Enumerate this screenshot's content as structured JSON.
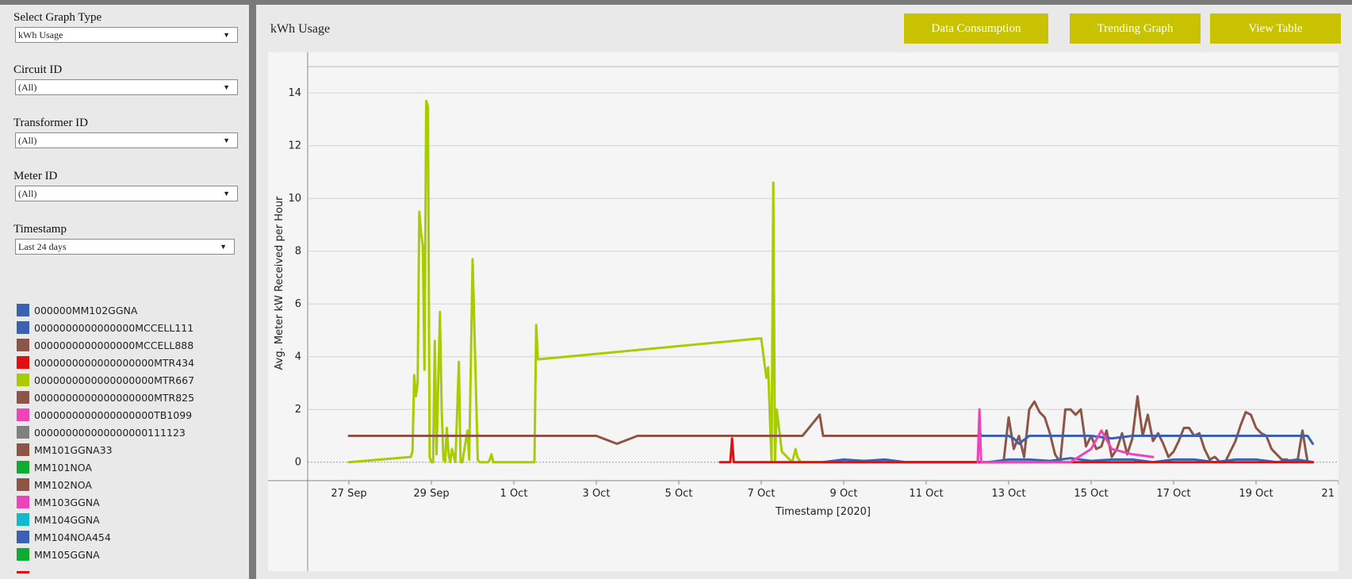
{
  "sidebar": {
    "filters": [
      {
        "label": "Select Graph Type",
        "value": "kWh Usage"
      },
      {
        "label": "Circuit ID",
        "value": "(All)"
      },
      {
        "label": "Transformer ID",
        "value": "(All)"
      },
      {
        "label": "Meter ID",
        "value": "(All)"
      },
      {
        "label": "Timestamp",
        "value": "Last 24 days"
      }
    ],
    "legend": [
      {
        "name": "000000MM102GGNA",
        "color": "#3a62b0"
      },
      {
        "name": "0000000000000000MCCELL111",
        "color": "#3a62b0"
      },
      {
        "name": "0000000000000000MCCELL888",
        "color": "#8c5545"
      },
      {
        "name": "0000000000000000000MTR434",
        "color": "#dd1111"
      },
      {
        "name": "0000000000000000000MTR667",
        "color": "#a8cc00"
      },
      {
        "name": "0000000000000000000MTR825",
        "color": "#8c5545"
      },
      {
        "name": "0000000000000000000TB1099",
        "color": "#ee44bb"
      },
      {
        "name": "000000000000000000111123",
        "color": "#808080"
      },
      {
        "name": "MM101GGNA33",
        "color": "#8c5545"
      },
      {
        "name": "MM101NOA",
        "color": "#11aa33"
      },
      {
        "name": "MM102NOA",
        "color": "#8c5545"
      },
      {
        "name": "MM103GGNA",
        "color": "#ee44bb"
      },
      {
        "name": "MM104GGNA",
        "color": "#11bbcc"
      },
      {
        "name": "MM104NOA454",
        "color": "#3a62b0"
      },
      {
        "name": "MM105GGNA",
        "color": "#11aa33"
      }
    ]
  },
  "main": {
    "title": "kWh Usage",
    "buttons": [
      "Data Consumption",
      "Trending Graph",
      "View Table"
    ],
    "button_color": "#c8c200"
  },
  "chart_data": {
    "type": "line",
    "xlabel": "Timestamp [2020]",
    "ylabel": "Avg. Meter kW Received per Hour",
    "ylim": [
      -0.7,
      15
    ],
    "xlim": [
      "2020-09-26",
      "2020-10-21"
    ],
    "yticks": [
      0,
      2,
      4,
      6,
      8,
      10,
      12,
      14
    ],
    "xticks": [
      "27 Sep",
      "29 Sep",
      "1 Oct",
      "3 Oct",
      "5 Oct",
      "7 Oct",
      "9 Oct",
      "11 Oct",
      "13 Oct",
      "15 Oct",
      "17 Oct",
      "19 Oct",
      "21 Oct"
    ],
    "grid": true,
    "series": [
      {
        "name": "0000000000000000000MTR667",
        "color": "#a8cc00",
        "x": [
          "2020-09-27T00:00",
          "2020-09-28T12:00",
          "2020-09-28T13:00",
          "2020-09-28T14:00",
          "2020-09-28T15:00",
          "2020-09-28T16:00",
          "2020-09-28T17:00",
          "2020-09-28T18:00",
          "2020-09-28T19:00",
          "2020-09-28T20:00",
          "2020-09-28T21:00",
          "2020-09-28T22:00",
          "2020-09-28T23:00",
          "2020-09-29T00:00",
          "2020-09-29T01:00",
          "2020-09-29T02:00",
          "2020-09-29T03:00",
          "2020-09-29T05:00",
          "2020-09-29T06:00",
          "2020-09-29T07:00",
          "2020-09-29T08:00",
          "2020-09-29T09:00",
          "2020-09-29T10:00",
          "2020-09-29T11:00",
          "2020-09-29T12:00",
          "2020-09-29T14:00",
          "2020-09-29T16:00",
          "2020-09-29T17:00",
          "2020-09-29T18:00",
          "2020-09-29T21:00",
          "2020-09-29T22:00",
          "2020-09-30T00:00",
          "2020-09-30T03:00",
          "2020-09-30T04:00",
          "2020-09-30T05:00",
          "2020-09-30T06:00",
          "2020-09-30T09:00",
          "2020-09-30T10:00",
          "2020-09-30T11:00",
          "2020-09-30T12:00",
          "2020-09-30T14:00",
          "2020-10-01T12:00",
          "2020-10-01T13:00",
          "2020-10-01T14:00",
          "2020-10-07T00:00",
          "2020-10-07T02:00",
          "2020-10-07T03:00",
          "2020-10-07T04:00",
          "2020-10-07T05:00",
          "2020-10-07T06:00",
          "2020-10-07T07:00",
          "2020-10-07T08:00",
          "2020-10-07T09:00",
          "2020-10-07T12:00",
          "2020-10-07T18:00",
          "2020-10-07T20:00",
          "2020-10-07T21:00",
          "2020-10-07T23:00",
          "2020-10-08T01:00",
          "2020-10-08T03:00",
          "2020-10-08T06:00",
          "2020-10-08T08:00",
          "2020-10-08T09:00",
          "2020-10-08T11:00"
        ],
        "y": [
          0,
          0.2,
          0.4,
          3.3,
          2.5,
          3.0,
          9.5,
          8.7,
          8.2,
          3.5,
          13.7,
          13.5,
          0.2,
          0,
          0,
          4.6,
          0.3,
          5.7,
          2.0,
          0.1,
          0,
          1.3,
          0.3,
          0,
          0.5,
          0,
          3.8,
          0,
          0,
          1.2,
          0.1,
          7.7,
          0.1,
          0,
          0,
          0,
          0,
          0.1,
          0.3,
          0,
          0,
          0,
          5.2,
          3.9,
          4.7,
          3.7,
          3.2,
          3.6,
          1.8,
          0,
          10.6,
          0,
          2.0,
          0.4,
          0,
          0.5,
          0.2,
          0,
          0,
          0,
          0,
          0,
          0,
          0
        ]
      },
      {
        "name": "0000000000000000MCCELL888",
        "color": "#8c5545",
        "x": [
          "2020-09-27T00:00",
          "2020-10-03T00:00",
          "2020-10-03T12:00",
          "2020-10-04T00:00",
          "2020-10-07T00:00",
          "2020-10-08T00:00",
          "2020-10-08T10:00",
          "2020-10-08T12:00",
          "2020-10-12T06:00",
          "2020-10-12T07:00",
          "2020-10-12T08:00",
          "2020-10-12T09:00",
          "2020-10-12T12:00"
        ],
        "y": [
          1.0,
          1.0,
          0.7,
          1.0,
          1.0,
          1.0,
          1.8,
          1.0,
          1.0,
          1.0,
          1.0,
          1.0,
          1.0
        ]
      },
      {
        "name": "0000000000000000000MTR825",
        "color": "#8c5545",
        "x": [
          "2020-10-12T12:00",
          "2020-10-12T15:00",
          "2020-10-12T18:00",
          "2020-10-12T21:00",
          "2020-10-13T00:00",
          "2020-10-13T03:00",
          "2020-10-13T06:00",
          "2020-10-13T09:00",
          "2020-10-13T12:00",
          "2020-10-13T15:00",
          "2020-10-13T18:00",
          "2020-10-13T21:00",
          "2020-10-14T00:00",
          "2020-10-14T03:00",
          "2020-10-14T06:00",
          "2020-10-14T09:00",
          "2020-10-14T12:00",
          "2020-10-14T15:00",
          "2020-10-14T18:00",
          "2020-10-14T21:00",
          "2020-10-15T00:00",
          "2020-10-15T03:00",
          "2020-10-15T06:00",
          "2020-10-15T09:00",
          "2020-10-15T12:00",
          "2020-10-15T15:00",
          "2020-10-15T18:00",
          "2020-10-15T21:00",
          "2020-10-16T00:00",
          "2020-10-16T03:00",
          "2020-10-16T06:00",
          "2020-10-16T09:00",
          "2020-10-16T12:00",
          "2020-10-16T15:00",
          "2020-10-16T18:00",
          "2020-10-16T21:00",
          "2020-10-17T00:00",
          "2020-10-17T03:00",
          "2020-10-17T06:00",
          "2020-10-17T09:00",
          "2020-10-17T12:00",
          "2020-10-17T15:00",
          "2020-10-17T18:00",
          "2020-10-17T21:00",
          "2020-10-18T00:00",
          "2020-10-18T03:00",
          "2020-10-18T06:00",
          "2020-10-18T09:00",
          "2020-10-18T12:00",
          "2020-10-18T15:00",
          "2020-10-18T18:00",
          "2020-10-18T21:00",
          "2020-10-19T00:00",
          "2020-10-19T03:00",
          "2020-10-19T06:00",
          "2020-10-19T09:00",
          "2020-10-19T12:00",
          "2020-10-19T15:00",
          "2020-10-19T18:00",
          "2020-10-19T21:00",
          "2020-10-20T00:00",
          "2020-10-20T03:00",
          "2020-10-20T06:00",
          "2020-10-20T09:00"
        ],
        "y": [
          0,
          0,
          0,
          0,
          1.7,
          0.5,
          1.0,
          0.2,
          2.0,
          2.3,
          1.9,
          1.7,
          1.1,
          0.3,
          0,
          2.0,
          2.0,
          1.8,
          2.0,
          0.6,
          1.0,
          0.5,
          0.6,
          1.2,
          0.2,
          0.5,
          1.1,
          0.3,
          0.9,
          2.5,
          1.0,
          1.8,
          0.8,
          1.1,
          0.7,
          0.2,
          0.4,
          0.8,
          1.3,
          1.3,
          1.0,
          1.1,
          0.5,
          0.1,
          0.2,
          0,
          0,
          0.4,
          0.8,
          1.4,
          1.9,
          1.8,
          1.3,
          1.1,
          1.0,
          0.5,
          0.3,
          0.1,
          0.1,
          0,
          0,
          1.2,
          0,
          0
        ]
      },
      {
        "name": "0000000000000000MCCELL111",
        "color": "#3a62b0",
        "x": [
          "2020-10-08T12:00",
          "2020-10-09T00:00",
          "2020-10-09T12:00",
          "2020-10-10T00:00",
          "2020-10-10T12:00",
          "2020-10-11T00:00",
          "2020-10-11T12:00",
          "2020-10-12T00:00",
          "2020-10-12T06:00",
          "2020-10-12T07:00",
          "2020-10-12T08:00",
          "2020-10-12T12:00",
          "2020-10-12T18:00",
          "2020-10-13T00:00",
          "2020-10-13T03:00",
          "2020-10-13T06:00",
          "2020-10-13T12:00",
          "2020-10-14T00:00",
          "2020-10-14T12:00",
          "2020-10-15T00:00",
          "2020-10-15T12:00",
          "2020-10-16T00:00",
          "2020-10-16T12:00",
          "2020-10-17T00:00",
          "2020-10-17T12:00",
          "2020-10-18T00:00",
          "2020-10-18T12:00",
          "2020-10-19T00:00",
          "2020-10-19T12:00",
          "2020-10-20T00:00",
          "2020-10-20T06:00",
          "2020-10-20T09:00"
        ],
        "y": [
          0,
          0.1,
          0.05,
          0.1,
          0,
          0,
          0,
          0,
          0,
          1.2,
          1.0,
          1.0,
          1.0,
          1.0,
          0.9,
          0.7,
          1.0,
          1.0,
          1.0,
          1.0,
          0.9,
          1.0,
          1.0,
          1.0,
          1.0,
          1.0,
          1.0,
          1.0,
          1.0,
          1.0,
          1.0,
          0.7
        ]
      },
      {
        "name": "000000MM102GGNA",
        "color": "#3a62b0",
        "x": [
          "2020-10-08T12:00",
          "2020-10-12T12:00",
          "2020-10-13T00:00",
          "2020-10-13T12:00",
          "2020-10-14T00:00",
          "2020-10-14T12:00",
          "2020-10-15T00:00",
          "2020-10-15T12:00",
          "2020-10-16T00:00",
          "2020-10-16T12:00",
          "2020-10-17T00:00",
          "2020-10-17T12:00",
          "2020-10-18T00:00",
          "2020-10-18T12:00",
          "2020-10-19T00:00",
          "2020-10-19T12:00",
          "2020-10-20T00:00",
          "2020-10-20T09:00"
        ],
        "y": [
          0,
          0,
          0.1,
          0.1,
          0.05,
          0.15,
          0.05,
          0.1,
          0.1,
          0,
          0.1,
          0.1,
          0,
          0.1,
          0.1,
          0,
          0.1,
          0
        ]
      },
      {
        "name": "0000000000000000000MTR434",
        "color": "#dd1111",
        "x": [
          "2020-10-06T00:00",
          "2020-10-06T06:00",
          "2020-10-06T07:00",
          "2020-10-06T08:00",
          "2020-10-14T00:00",
          "2020-10-20T09:00"
        ],
        "y": [
          0,
          0,
          0.9,
          0,
          0,
          0
        ]
      },
      {
        "name": "0000000000000000000TB1099",
        "color": "#ee44bb",
        "x": [
          "2020-10-12T06:00",
          "2020-10-12T07:00",
          "2020-10-12T08:00",
          "2020-10-14T12:00",
          "2020-10-15T00:00",
          "2020-10-15T06:00",
          "2020-10-15T12:00",
          "2020-10-16T00:00",
          "2020-10-16T12:00"
        ],
        "y": [
          0,
          2.0,
          0,
          0,
          0.5,
          1.2,
          0.5,
          0.3,
          0.2
        ]
      }
    ]
  }
}
